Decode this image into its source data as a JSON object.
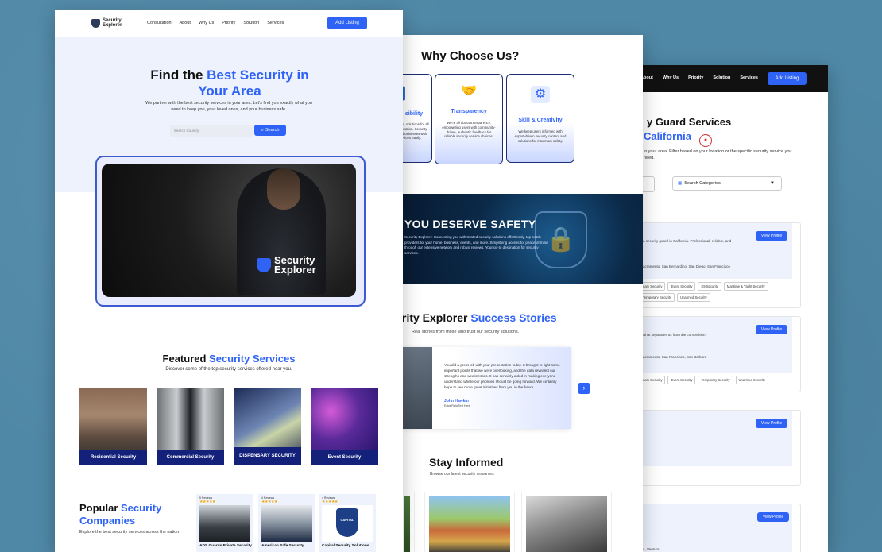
{
  "front": {
    "logo": {
      "line1": "Security",
      "line2": "Explorer"
    },
    "nav": [
      "Consultation",
      "About",
      "Why Us",
      "Priority",
      "Solution",
      "Services"
    ],
    "add_listing": "Add Listing",
    "hero": {
      "title_a": "Find the ",
      "title_b": "Best Security in",
      "title_c": "Your Area",
      "desc": "We partner with the best security services in your area. Let's find you exactly what you need to keep you, your loved ones, and your business safe.",
      "search_placeholder": "Search Country",
      "search_button": "Search",
      "photo_logo_1": "Security",
      "photo_logo_2": "Explorer"
    },
    "featured": {
      "title_a": "Featured ",
      "title_b": "Security Services",
      "subtitle": "Discover some of the top security services offered near you.",
      "services": [
        "Residential Security",
        "Commercial Security",
        "DISPENSARY SECURITY",
        "Event Security"
      ]
    },
    "popular": {
      "title_a": "Popular ",
      "title_b": "Security",
      "title_c": "Companies",
      "desc": "Explore the best security services across the nation.",
      "companies": [
        {
          "reviews": "5 Reviews",
          "stars": "★★★★★",
          "name": "ADS Guards Private Security"
        },
        {
          "reviews": "4 Reviews",
          "stars": "★★★★★",
          "name": "American Safe Security"
        },
        {
          "reviews": "4 Reviews",
          "stars": "★★★★★",
          "name": "Capital Security Solutions"
        }
      ],
      "capital_badge": "CAPITAL"
    }
  },
  "middle": {
    "why": {
      "title": "Why Choose Us?",
      "cards": [
        {
          "title": "sibility",
          "desc": "ffer accessible, solutions for all. Budget or location. Security connecting businesses with urity services easily."
        },
        {
          "title": "Transparency",
          "desc": "We're all about transparency, empowering users with community-driven, authentic feedback for reliable security service choices."
        },
        {
          "title": "Skill & Creativity",
          "desc": "We keep users informed with expert-driven security content and solutions for maximum safety."
        }
      ]
    },
    "safety": {
      "title": "YOU DESERVE SAFETY",
      "desc": "Security Explorer: Connecting you with trusted security solutions effortlessly. top-notch providers for your home, business, events, and more. Simplifying access for peace of mind through our extensive network and robust reviews. Your go-to destination for security services."
    },
    "stories": {
      "title_a": "rity Explorer ",
      "title_b": "Success Stories",
      "subtitle": "Real stories from those who trust our security solutions.",
      "quote": "You did a great job with your presentation today. It brought to light some important points that we were overlooking, and the data revealed our strengths and weaknesses. It has certainly aided in making everyone understand where our priorities should be going forward. We certainly hope to see more great initiatives from you in the future.",
      "name": "John Hawkin",
      "role": "Extra Field Text Here",
      "next": "›"
    },
    "informed": {
      "title": "Stay Informed",
      "subtitle": "Browse our latest security resources"
    }
  },
  "back": {
    "nav": [
      "About",
      "Why Us",
      "Priority",
      "Solution",
      "Services"
    ],
    "add_listing": "Add Listing",
    "title_a": "y Guard Services",
    "title_b": "California",
    "desc": "in your area. Filter based on your location or the specific security service you need.",
    "search_categories": "Search Categories",
    "caret": "▼",
    "view_profile": "View Profile",
    "cards": [
      {
        "desc": "a security guard in California. Professional, reliable, and",
        "loc": "acramento, San Bernardino, San Diego, San Francisco",
        "tags": [
          "nary Security",
          "Event Security",
          "K9 Security",
          "Maritime & Yacht Security",
          "Temporary Security",
          "Unarmed Security"
        ]
      },
      {
        "desc": "what separates us from the competition",
        "loc": "acramento, San Francisco, San Barbara",
        "tags": [
          "nary Security",
          "Event Security",
          "Temporary Security",
          "Unarmed Security"
        ]
      },
      {
        "desc": "",
        "loc": "",
        "tags": []
      },
      {
        "desc": "",
        "loc": "a, Ventura",
        "tags": []
      }
    ]
  }
}
